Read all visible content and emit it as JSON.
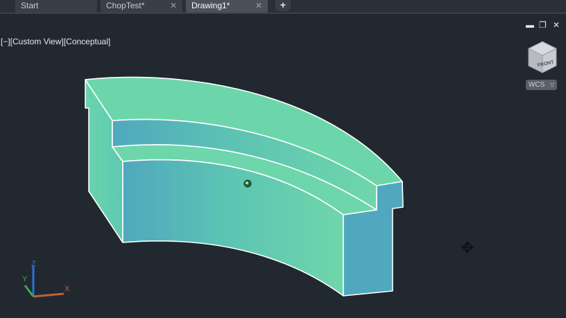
{
  "tabs": [
    {
      "label": "Start",
      "closable": false,
      "active": false
    },
    {
      "label": "ChopTest*",
      "closable": true,
      "active": false
    },
    {
      "label": "Drawing1*",
      "closable": true,
      "active": true
    }
  ],
  "tab_close_glyph": "✕",
  "new_tab_glyph": "+",
  "viewport": {
    "view_controls": "[−][Custom View][Conceptual]",
    "window_controls": {
      "minimize": "▬",
      "restore": "❐",
      "close": "✕"
    }
  },
  "viewcube": {
    "face_label": "FRONT",
    "wcs_label": "WCS",
    "wcs_dropdown_glyph": "▽"
  },
  "ucs": {
    "x_label": "X",
    "y_label": "Y",
    "z_label": "Z"
  },
  "colors": {
    "background": "#212830",
    "model_top": "#6cd6aa",
    "model_side_dark": "#4fa8bd",
    "model_side_light": "#6dd4ad",
    "edge": "#ffffff"
  },
  "icons": [
    "viewcube-icon",
    "ucs-icon",
    "orbit-target-icon",
    "pan-cursor-icon"
  ]
}
